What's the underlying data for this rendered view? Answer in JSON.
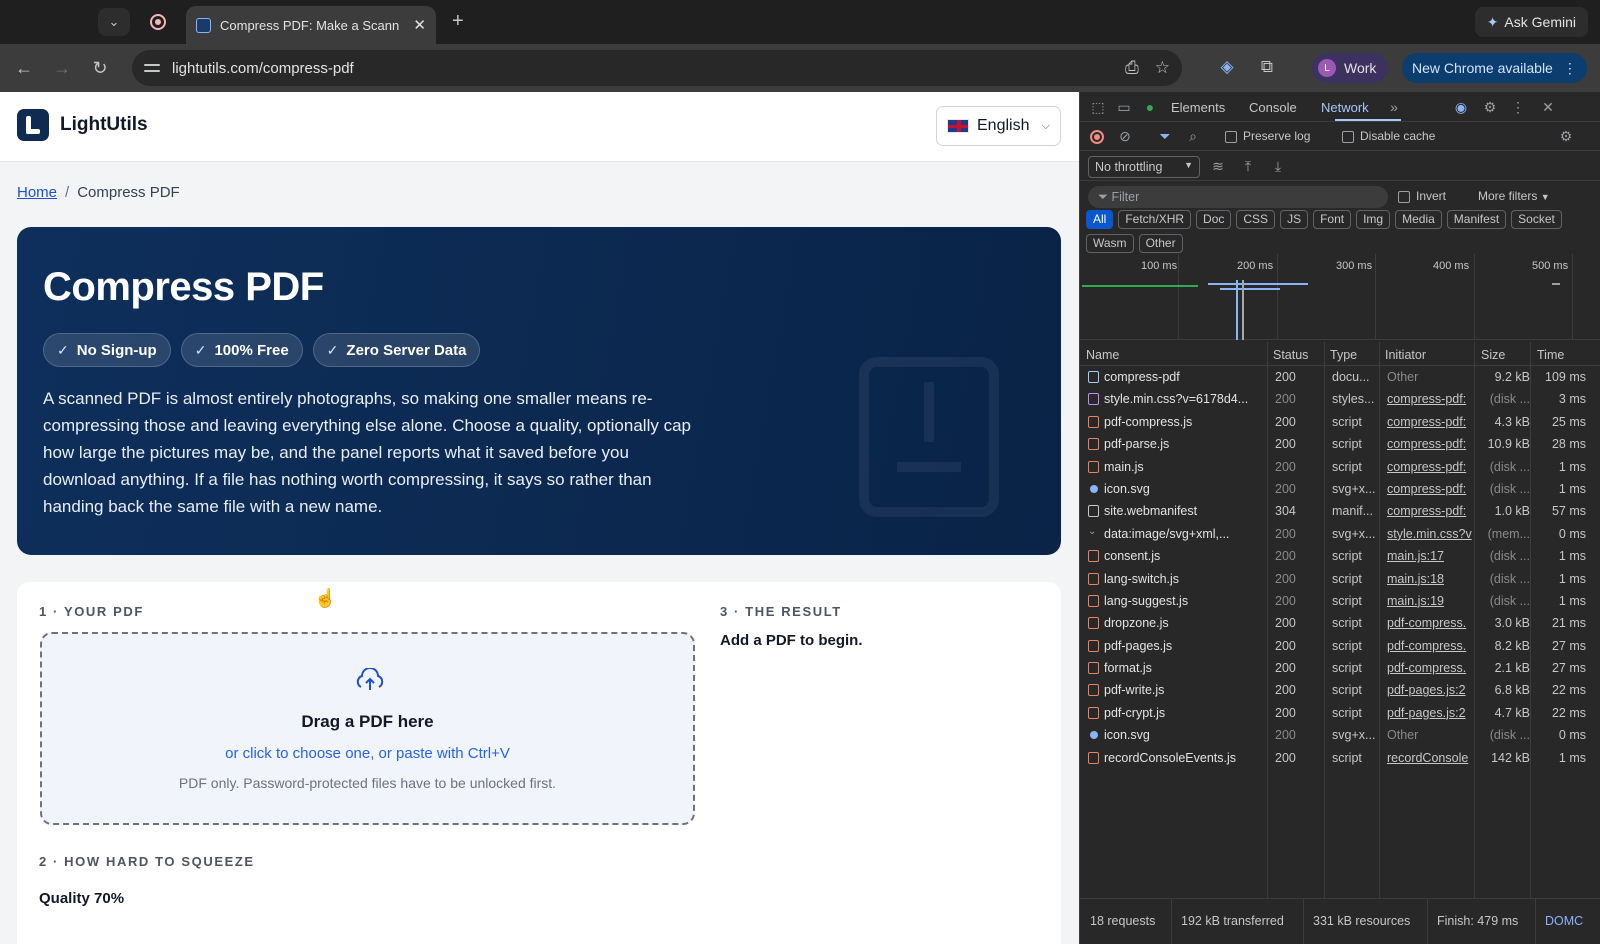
{
  "browser": {
    "tab_title": "Compress PDF: Make a Scann",
    "url": "lightutils.com/compress-pdf",
    "ask_gemini": "Ask Gemini",
    "profile_label": "Work",
    "profile_initial": "L",
    "update_label": "New Chrome available"
  },
  "site": {
    "logo_text": "LightUtils",
    "language": "English",
    "breadcrumb_home": "Home",
    "breadcrumb_current": "Compress PDF"
  },
  "hero": {
    "title": "Compress PDF",
    "badges": [
      "No Sign-up",
      "100% Free",
      "Zero Server Data"
    ],
    "description": "A scanned PDF is almost entirely photographs, so making one smaller means re-compressing those and leaving everything else alone. Choose a quality, optionally cap how large the pictures may be, and the panel reports what it saved before you download anything. If a file has nothing worth compressing, it says so rather than handing back the same file with a new name."
  },
  "tool": {
    "step1": "1 · YOUR PDF",
    "step2": "2 · HOW HARD TO SQUEEZE",
    "step3": "3 · THE RESULT",
    "dropzone_title": "Drag a PDF here",
    "dropzone_link": "or click to choose one, or paste with Ctrl+V",
    "dropzone_note": "PDF only. Password-protected files have to be unlocked first.",
    "result_empty": "Add a PDF to begin.",
    "quality_label": "Quality 70%"
  },
  "devtools": {
    "tabs": [
      "Elements",
      "Console",
      "Network"
    ],
    "active_tab": "Network",
    "preserve_log": "Preserve log",
    "disable_cache": "Disable cache",
    "throttling": "No throttling",
    "filter_placeholder": "Filter",
    "invert": "Invert",
    "more_filters": "More filters",
    "type_filters": [
      "All",
      "Fetch/XHR",
      "Doc",
      "CSS",
      "JS",
      "Font",
      "Img",
      "Media",
      "Manifest",
      "Socket",
      "Wasm",
      "Other"
    ],
    "timeline_labels": [
      "100 ms",
      "200 ms",
      "300 ms",
      "400 ms",
      "500 ms"
    ],
    "columns": [
      "Name",
      "Status",
      "Type",
      "Initiator",
      "Size",
      "Time"
    ],
    "requests": [
      {
        "name": "compress-pdf",
        "status": "200",
        "type": "docu...",
        "initiator": "Other",
        "size": "9.2 kB",
        "time": "109 ms",
        "kind": "doc",
        "dim": false
      },
      {
        "name": "style.min.css?v=6178d4...",
        "status": "200",
        "type": "styles...",
        "initiator": "compress-pdf:",
        "size": "(disk ...",
        "time": "3 ms",
        "kind": "css",
        "dim": true
      },
      {
        "name": "pdf-compress.js",
        "status": "200",
        "type": "script",
        "initiator": "compress-pdf:",
        "size": "4.3 kB",
        "time": "25 ms",
        "kind": "js",
        "dim": false
      },
      {
        "name": "pdf-parse.js",
        "status": "200",
        "type": "script",
        "initiator": "compress-pdf:",
        "size": "10.9 kB",
        "time": "28 ms",
        "kind": "js",
        "dim": false
      },
      {
        "name": "main.js",
        "status": "200",
        "type": "script",
        "initiator": "compress-pdf:",
        "size": "(disk ...",
        "time": "1 ms",
        "kind": "js",
        "dim": true
      },
      {
        "name": "icon.svg",
        "status": "200",
        "type": "svg+x...",
        "initiator": "compress-pdf:",
        "size": "(disk ...",
        "time": "1 ms",
        "kind": "img",
        "dim": true
      },
      {
        "name": "site.webmanifest",
        "status": "304",
        "type": "manif...",
        "initiator": "compress-pdf:",
        "size": "1.0 kB",
        "time": "57 ms",
        "kind": "manifest",
        "dim": false
      },
      {
        "name": "data:image/svg+xml,...",
        "status": "200",
        "type": "svg+x...",
        "initiator": "style.min.css?v",
        "size": "(mem...",
        "time": "0 ms",
        "kind": "data",
        "dim": true
      },
      {
        "name": "consent.js",
        "status": "200",
        "type": "script",
        "initiator": "main.js:17",
        "size": "(disk ...",
        "time": "1 ms",
        "kind": "js",
        "dim": true
      },
      {
        "name": "lang-switch.js",
        "status": "200",
        "type": "script",
        "initiator": "main.js:18",
        "size": "(disk ...",
        "time": "1 ms",
        "kind": "js",
        "dim": true
      },
      {
        "name": "lang-suggest.js",
        "status": "200",
        "type": "script",
        "initiator": "main.js:19",
        "size": "(disk ...",
        "time": "1 ms",
        "kind": "js",
        "dim": true
      },
      {
        "name": "dropzone.js",
        "status": "200",
        "type": "script",
        "initiator": "pdf-compress.",
        "size": "3.0 kB",
        "time": "21 ms",
        "kind": "js",
        "dim": false
      },
      {
        "name": "pdf-pages.js",
        "status": "200",
        "type": "script",
        "initiator": "pdf-compress.",
        "size": "8.2 kB",
        "time": "27 ms",
        "kind": "js",
        "dim": false
      },
      {
        "name": "format.js",
        "status": "200",
        "type": "script",
        "initiator": "pdf-compress.",
        "size": "2.1 kB",
        "time": "27 ms",
        "kind": "js",
        "dim": false
      },
      {
        "name": "pdf-write.js",
        "status": "200",
        "type": "script",
        "initiator": "pdf-pages.js:2",
        "size": "6.8 kB",
        "time": "22 ms",
        "kind": "js",
        "dim": false
      },
      {
        "name": "pdf-crypt.js",
        "status": "200",
        "type": "script",
        "initiator": "pdf-pages.js:2",
        "size": "4.7 kB",
        "time": "22 ms",
        "kind": "js",
        "dim": false
      },
      {
        "name": "icon.svg",
        "status": "200",
        "type": "svg+x...",
        "initiator": "Other",
        "size": "(disk ...",
        "time": "0 ms",
        "kind": "img",
        "dim": true
      },
      {
        "name": "recordConsoleEvents.js",
        "status": "200",
        "type": "script",
        "initiator": "recordConsole",
        "size": "142 kB",
        "time": "1 ms",
        "kind": "js",
        "dim": false
      }
    ],
    "summary": {
      "requests": "18 requests",
      "transferred": "192 kB transferred",
      "resources": "331 kB resources",
      "finish": "Finish: 479 ms",
      "domc": "DOMC"
    }
  }
}
